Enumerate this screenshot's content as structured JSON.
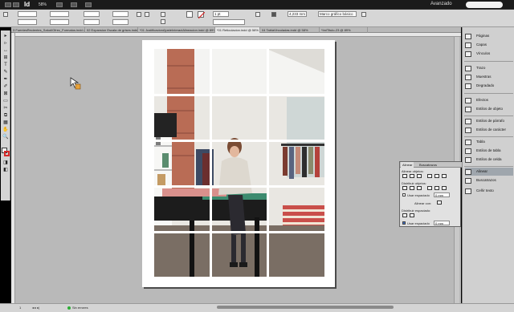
{
  "app": {
    "logo": "Id",
    "zoom": "58%",
    "workspace": "Avanzado"
  },
  "control_bar": {
    "stroke_weight": "1 pt",
    "offset_value": "4,233 mm",
    "frame_fitting": "Marco gráfico básico",
    "fill_color": "#ffffff",
    "stroke_color": "#d62a2a"
  },
  "tabs": [
    "3 FuentesRecientes_Salud/Ofrec_Formatos.indd @ 58%",
    "02 Expansion Escala de grises.indd @ 53%",
    "*01 JustificacionAjusteInteractAlineacion.indd @ 89%",
    "*01 Reticulacion.indd @ 58%",
    "04 TablaVinculadas.indd @ 58%",
    "*ImiTitulo-23 @ 89%"
  ],
  "active_tab_index": 3,
  "tools": [
    "▸",
    "▹",
    "↔",
    "⊞",
    "T",
    "✎",
    "✒",
    "✐",
    "⊠",
    "▭",
    "✂",
    "⧉",
    "▦",
    "✋",
    "🔍",
    "◨",
    "◧"
  ],
  "dock": {
    "group1": [
      {
        "icon": "pages-icon",
        "label": "Páginas"
      },
      {
        "icon": "layers-icon",
        "label": "Capas"
      },
      {
        "icon": "links-icon",
        "label": "Vínculos"
      }
    ],
    "group2": [
      {
        "icon": "stroke-icon",
        "label": "Trazo"
      },
      {
        "icon": "swatches-icon",
        "label": "Muestras"
      },
      {
        "icon": "gradient-icon",
        "label": "Degradado"
      }
    ],
    "group3": [
      {
        "icon": "effects-icon",
        "label": "Efectos"
      },
      {
        "icon": "object-styles-icon",
        "label": "Estilos de objeto"
      }
    ],
    "group4": [
      {
        "icon": "paragraph-styles-icon",
        "label": "Estilos de párrafo"
      },
      {
        "icon": "character-styles-icon",
        "label": "Estilos de carácter"
      }
    ],
    "group5": [
      {
        "icon": "table-icon",
        "label": "Tabla"
      },
      {
        "icon": "table-styles-icon",
        "label": "Estilos de tabla"
      },
      {
        "icon": "cell-styles-icon",
        "label": "Estilos de celda"
      }
    ],
    "group6": [
      {
        "icon": "align-icon",
        "label": "Alinear",
        "selected": true
      },
      {
        "icon": "pathfinder-icon",
        "label": "Buscatrazos"
      },
      {
        "icon": "wrap-icon",
        "label": "Ceñir texto"
      }
    ]
  },
  "align_panel": {
    "tabs": [
      "Alinear",
      "Buscatrazos"
    ],
    "align_objects": "Alinear objetos:",
    "distribute_objects": "Distribuir objetos:",
    "use_spacing_1": "Usar espaciado",
    "spacing_value_1": "0 mm",
    "align_to": "Alinear con:",
    "distribute_spacing": "Distribuir espaciado:",
    "use_spacing_2": "Usar espaciado",
    "spacing_value_2": "0 mm"
  },
  "status": {
    "page": "1",
    "preflight": "Sin errores"
  }
}
